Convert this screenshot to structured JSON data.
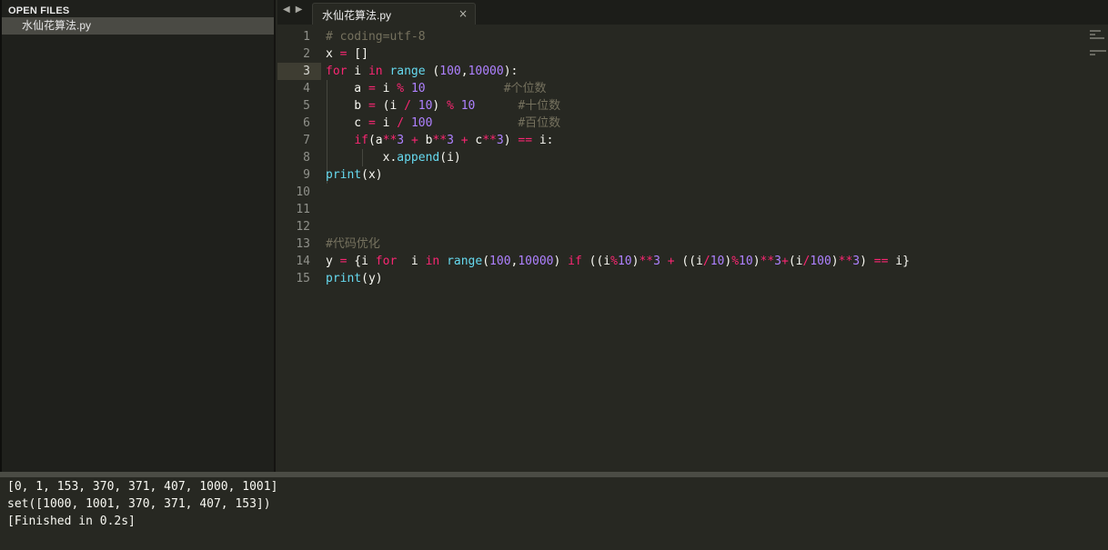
{
  "sidebar": {
    "header": "OPEN FILES",
    "files": [
      "水仙花算法.py"
    ]
  },
  "tabbar": {
    "nav_left": "◀",
    "nav_right": "▶",
    "tabs": [
      {
        "label": "水仙花算法.py",
        "close": "×"
      }
    ]
  },
  "editor": {
    "line_numbers": [
      "1",
      "2",
      "3",
      "4",
      "5",
      "6",
      "7",
      "8",
      "9",
      "10",
      "11",
      "12",
      "13",
      "14",
      "15"
    ],
    "current_line": 3,
    "lines": [
      "# coding=utf-8",
      "x = []",
      "for i in range (100,10000):",
      "    a = i % 10           #个位数",
      "    b = (i / 10) % 10      #十位数",
      "    c = i / 100            #百位数",
      "    if(a**3 + b**3 + c**3) == i:",
      "        x.append(i)",
      "print(x)",
      "",
      "",
      "",
      "#代码优化",
      "y = {i for  i in range(100,10000) if ((i%10)**3 + ((i/10)%10)**3+(i/100)**3) == i}",
      "print(y)"
    ]
  },
  "output": {
    "lines": [
      "[0, 1, 153, 370, 371, 407, 1000, 1001]",
      "set([1000, 1001, 370, 371, 407, 153])",
      "[Finished in 0.2s]"
    ]
  },
  "theme": {
    "background": "#272822",
    "keyword": "#f92672",
    "function": "#66d9ef",
    "number": "#ae81ff",
    "comment": "#75715e"
  }
}
